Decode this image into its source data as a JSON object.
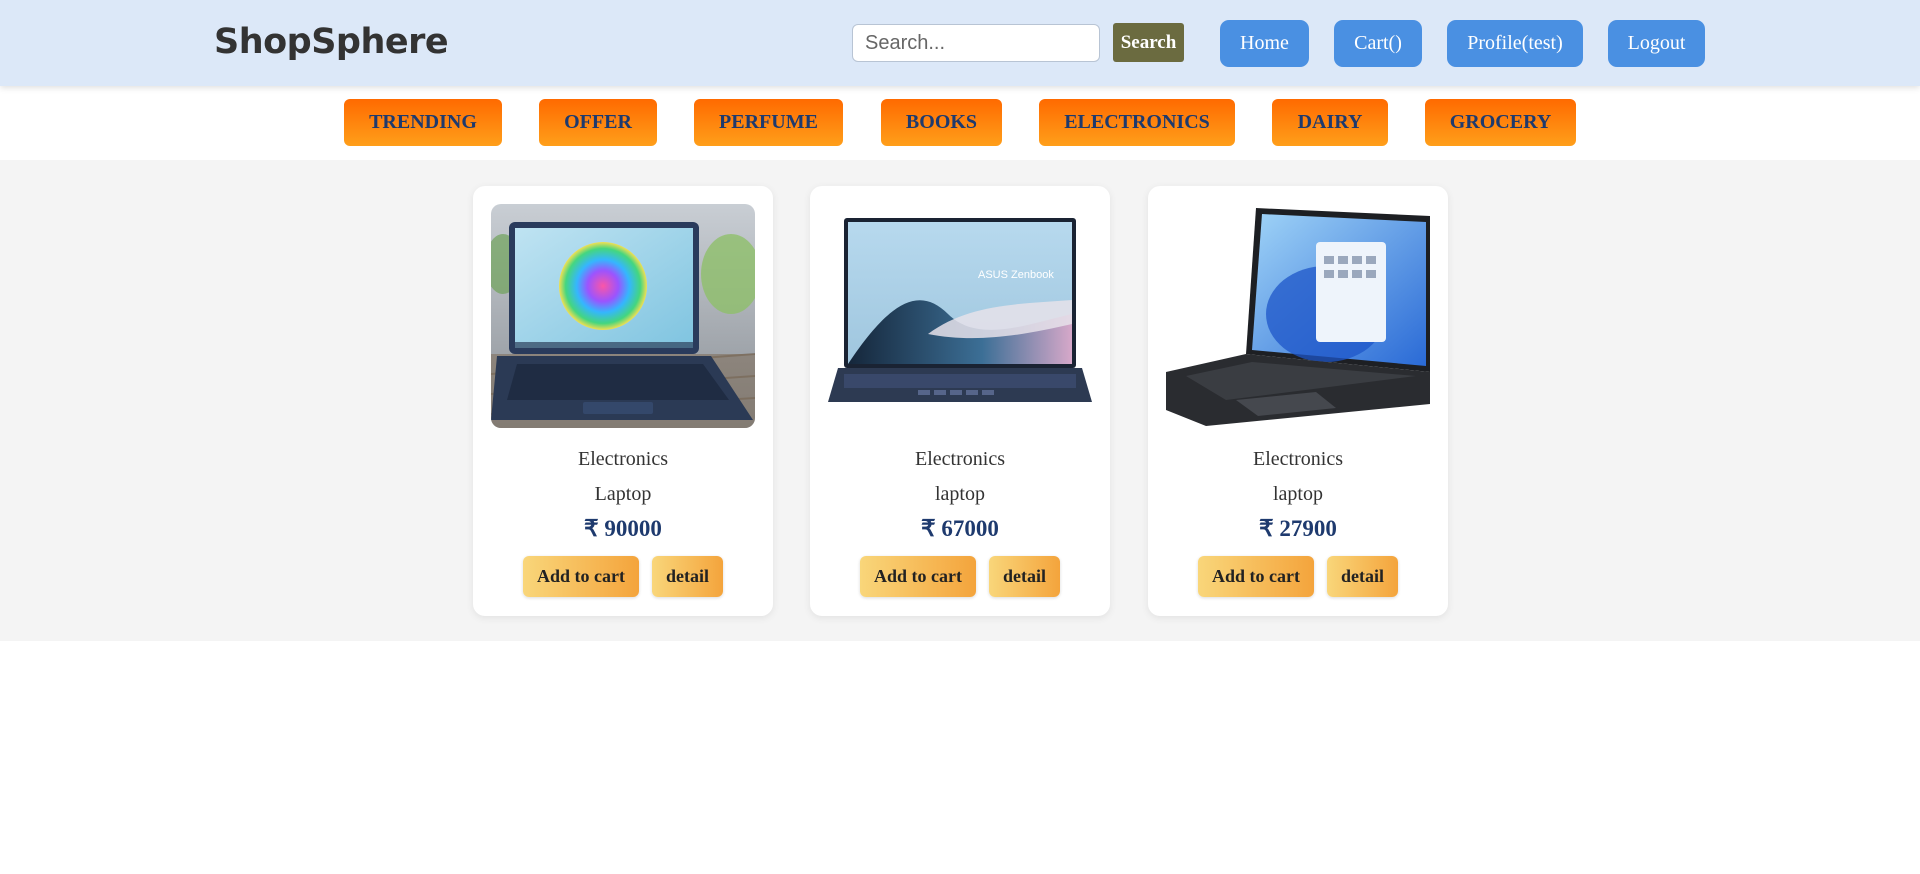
{
  "header": {
    "brand": "ShopSphere",
    "search": {
      "placeholder": "Search...",
      "value": "",
      "button_label": "Search"
    },
    "nav": {
      "home": "Home",
      "cart": "Cart()",
      "profile": "Profile(test)",
      "logout": "Logout"
    }
  },
  "categories": [
    "TRENDING",
    "OFFER",
    "PERFUME",
    "BOOKS",
    "ELECTRONICS",
    "DAIRY",
    "GROCERY"
  ],
  "products": [
    {
      "category": "Electronics",
      "name": "Laptop",
      "price": "₹ 90000",
      "add_to_cart_label": "Add to cart",
      "detail_label": "detail",
      "image_icon": "laptop-image"
    },
    {
      "category": "Electronics",
      "name": "laptop",
      "price": "₹ 67000",
      "add_to_cart_label": "Add to cart",
      "detail_label": "detail",
      "image_icon": "laptop-image",
      "image_text": "ASUS Zenbook"
    },
    {
      "category": "Electronics",
      "name": "laptop",
      "price": "₹ 27900",
      "add_to_cart_label": "Add to cart",
      "detail_label": "detail",
      "image_icon": "laptop-image"
    }
  ],
  "colors": {
    "header_bg": "#dce8f8",
    "nav_button": "#4a90e2",
    "search_button": "#6b6b40",
    "category_gradient": [
      "#ff6a00",
      "#ff9f1a"
    ],
    "category_text": "#1e3a6e",
    "price_text": "#1e3a6e",
    "action_gradient": [
      "#f9d67a",
      "#f4a43c"
    ],
    "products_bg": "#f4f4f4"
  }
}
